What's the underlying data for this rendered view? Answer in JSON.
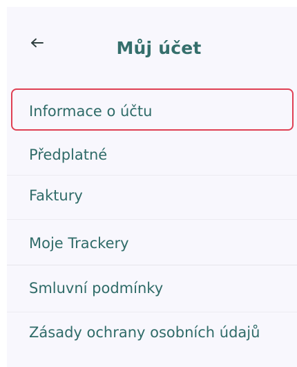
{
  "header": {
    "title": "Můj účet",
    "back_icon": "arrow-left-icon"
  },
  "menu": {
    "selected_index": 0,
    "items": [
      {
        "label": "Informace o účtu"
      },
      {
        "label": "Předplatné"
      },
      {
        "label": "Faktury"
      },
      {
        "label": "Moje Trackery"
      },
      {
        "label": "Smluvní podmínky"
      },
      {
        "label": "Zásady ochrany osobních údajů"
      }
    ]
  },
  "colors": {
    "text": "#2f6b68",
    "title": "#356f6c",
    "background": "#f8f7fd",
    "selection_border": "#df3f53"
  }
}
